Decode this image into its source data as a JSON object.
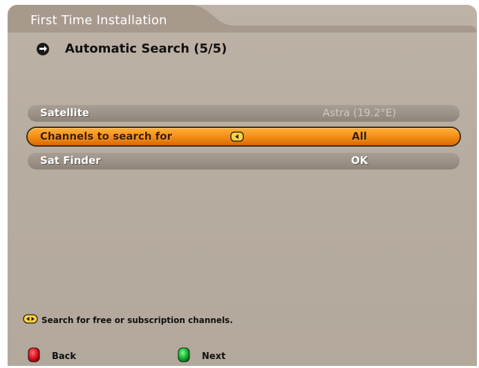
{
  "header": {
    "title": "First Time Installation",
    "subtitle": "Automatic Search (5/5)",
    "nav_icon": "arrow-circle-icon"
  },
  "menu": {
    "rows": [
      {
        "label": "Satellite",
        "value": "Astra (19.2°E)",
        "state": "disabled"
      },
      {
        "label": "Channels to search for",
        "value": "All",
        "state": "selected"
      },
      {
        "label": "Sat Finder",
        "value": "OK",
        "state": "normal"
      }
    ]
  },
  "help": {
    "icon": "left-right-arrows-icon",
    "text": "Search for free or subscription channels."
  },
  "footer": {
    "back_label": "Back",
    "next_label": "Next",
    "back_color": "#e01020",
    "next_color": "#10b030"
  },
  "colors": {
    "panel": "#b9aea2",
    "highlight": "#f38a14",
    "row": "#9c9186"
  }
}
